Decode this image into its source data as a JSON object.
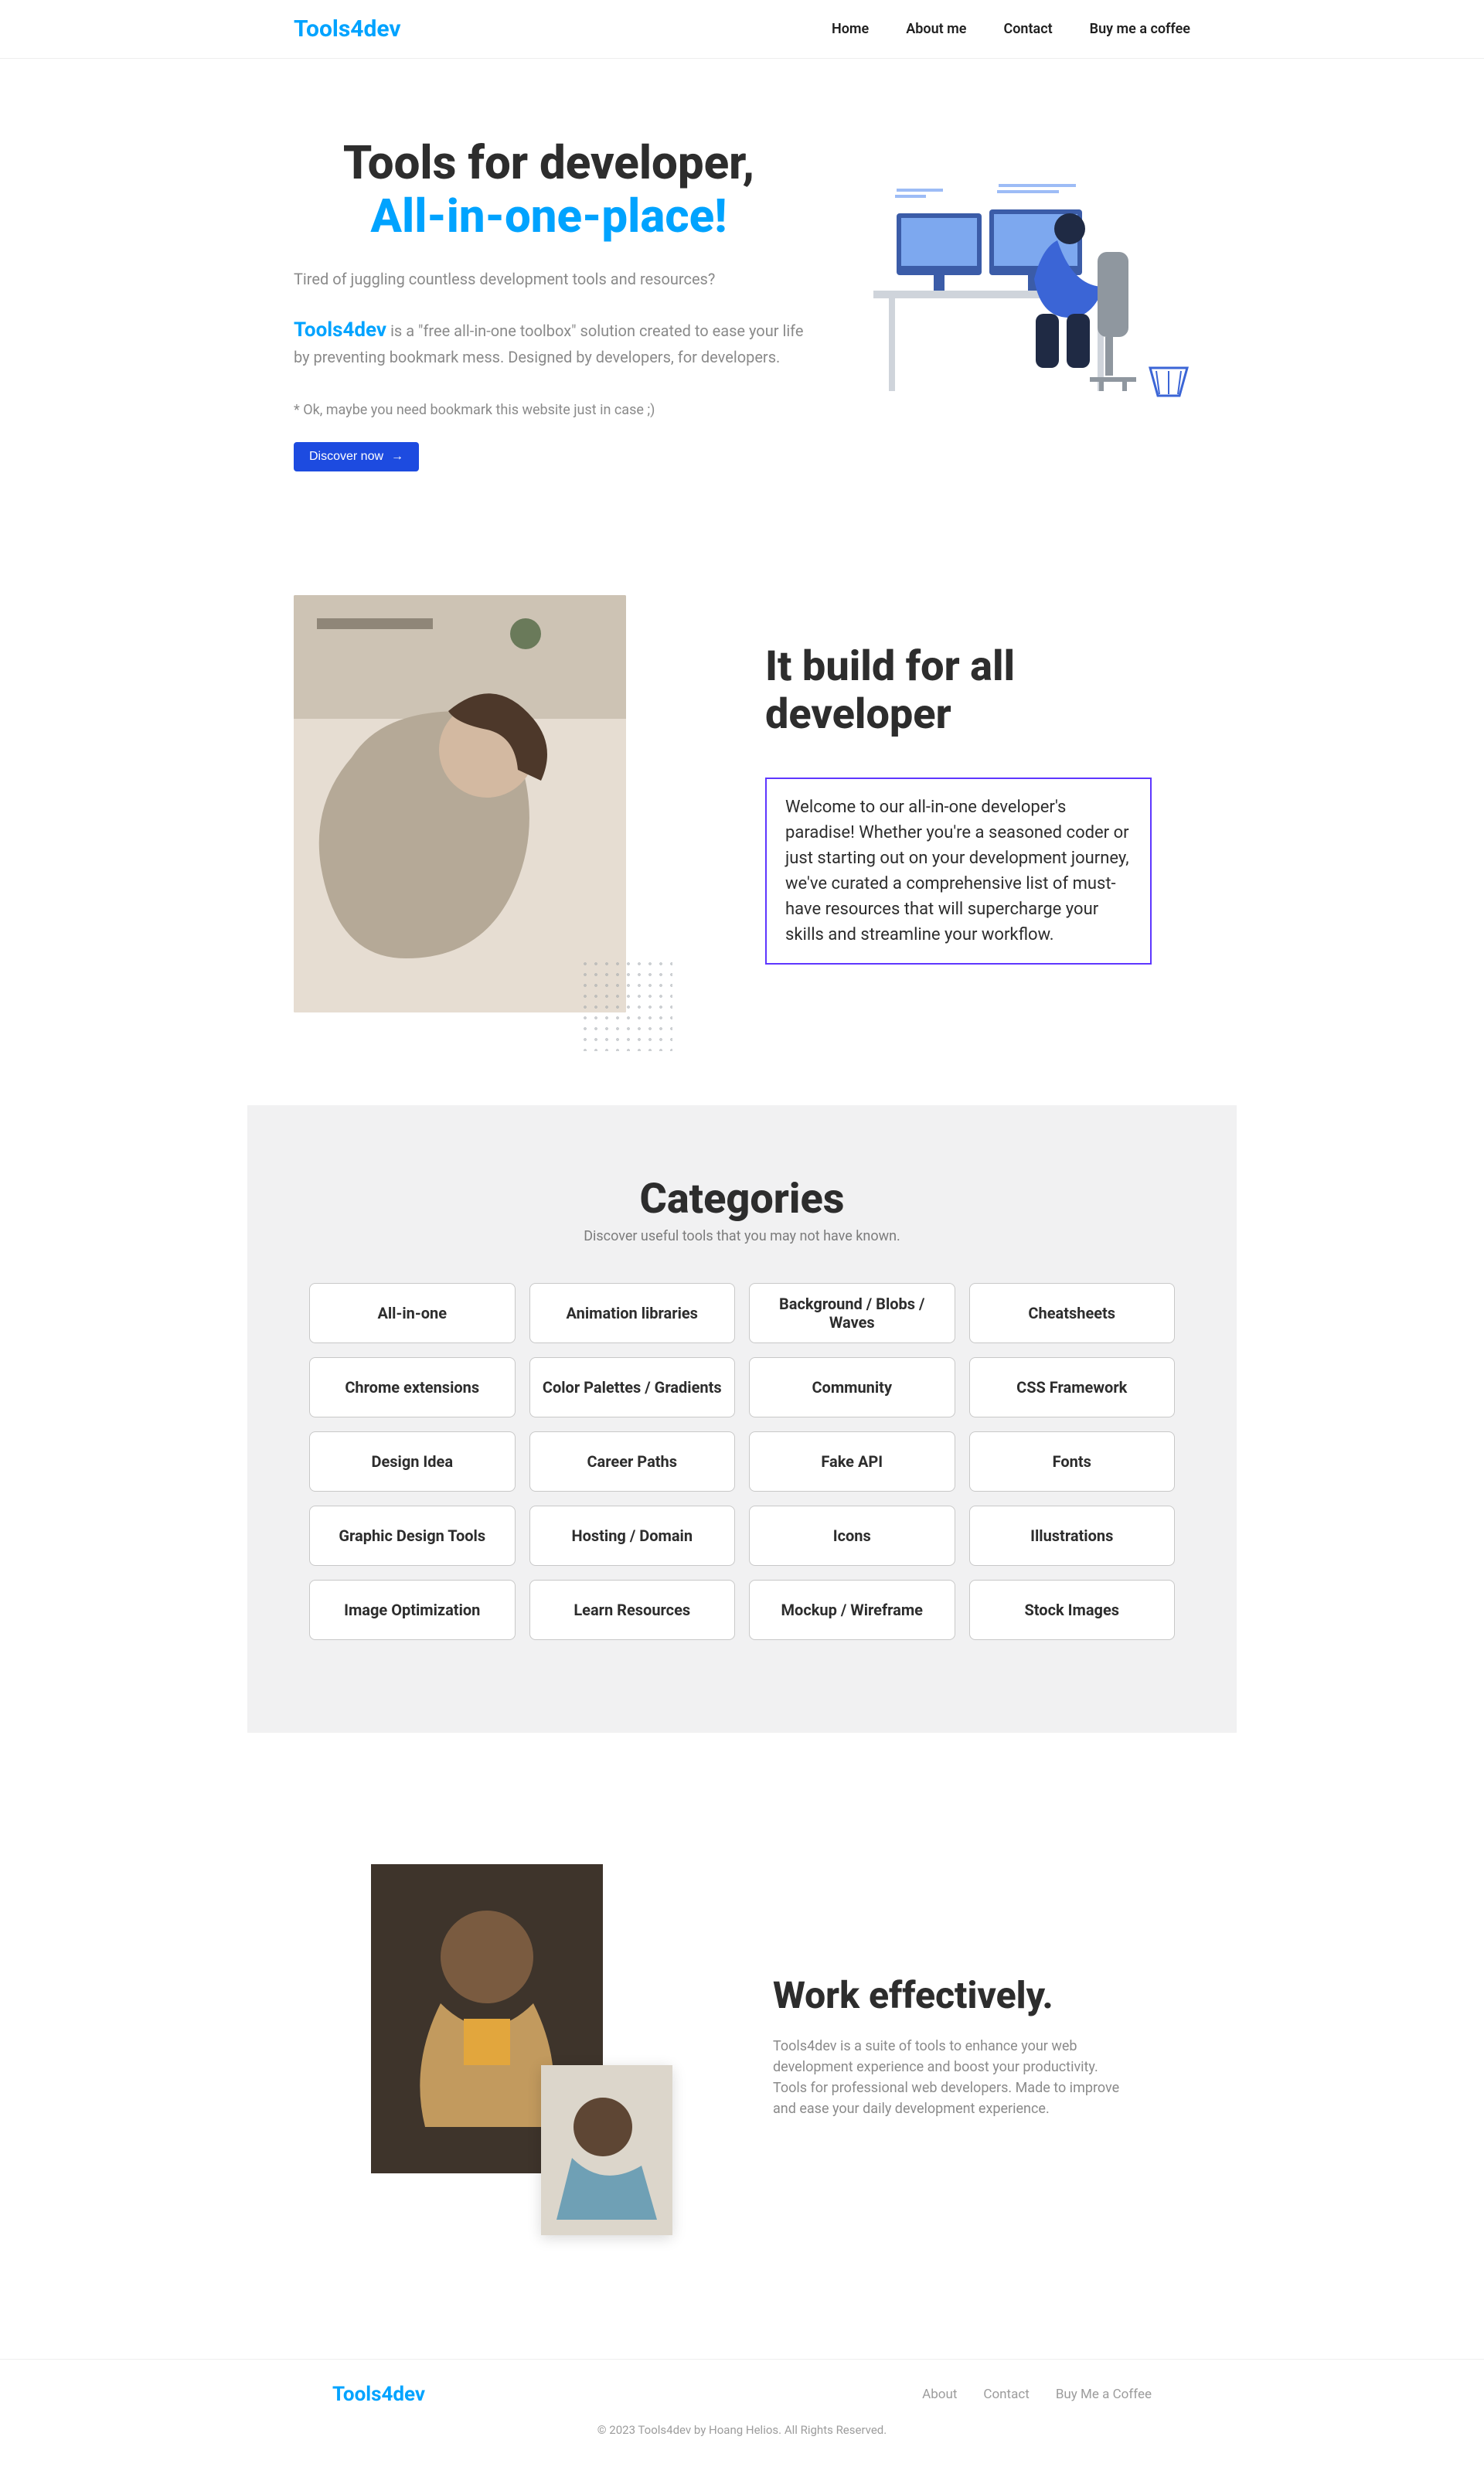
{
  "header": {
    "logo": "Tools4dev",
    "nav": [
      "Home",
      "About me",
      "Contact",
      "Buy me a coffee"
    ]
  },
  "hero": {
    "title_line1": "Tools for developer,",
    "title_line2": "All-in-one-place!",
    "intro": "Tired of juggling countless development tools and resources?",
    "brand": "Tools4dev",
    "desc": " is a \"free all-in-one toolbox\" solution created to ease your life by preventing bookmark mess. Designed by developers, for developers.",
    "footnote": "* Ok, maybe you need bookmark this website just in case ;)",
    "button": "Discover now"
  },
  "built": {
    "heading": "It build for all developer",
    "body": "Welcome to our all-in-one developer's paradise! Whether you're a seasoned coder or just starting out on your development journey, we've curated a comprehensive list of must-have resources that will supercharge your skills and streamline your workflow."
  },
  "categories": {
    "heading": "Categories",
    "sub": "Discover useful tools that you may not have known.",
    "items": [
      "All-in-one",
      "Animation libraries",
      "Background / Blobs / Waves",
      "Cheatsheets",
      "Chrome extensions",
      "Color Palettes / Gradients",
      "Community",
      "CSS Framework",
      "Design Idea",
      "Career Paths",
      "Fake API",
      "Fonts",
      "Graphic Design Tools",
      "Hosting / Domain",
      "Icons",
      "Illustrations",
      "Image Optimization",
      "Learn Resources",
      "Mockup / Wireframe",
      "Stock Images"
    ]
  },
  "work": {
    "heading": "Work effectively.",
    "body": "Tools4dev is a suite of tools to enhance your web development experience and boost your productivity. Tools for professional web developers. Made to improve and ease your daily development experience."
  },
  "footer": {
    "logo": "Tools4dev",
    "nav": [
      "About",
      "Contact",
      "Buy Me a Coffee"
    ],
    "copyright": "© 2023 Tools4dev by Hoang Helios. All Rights Reserved."
  }
}
